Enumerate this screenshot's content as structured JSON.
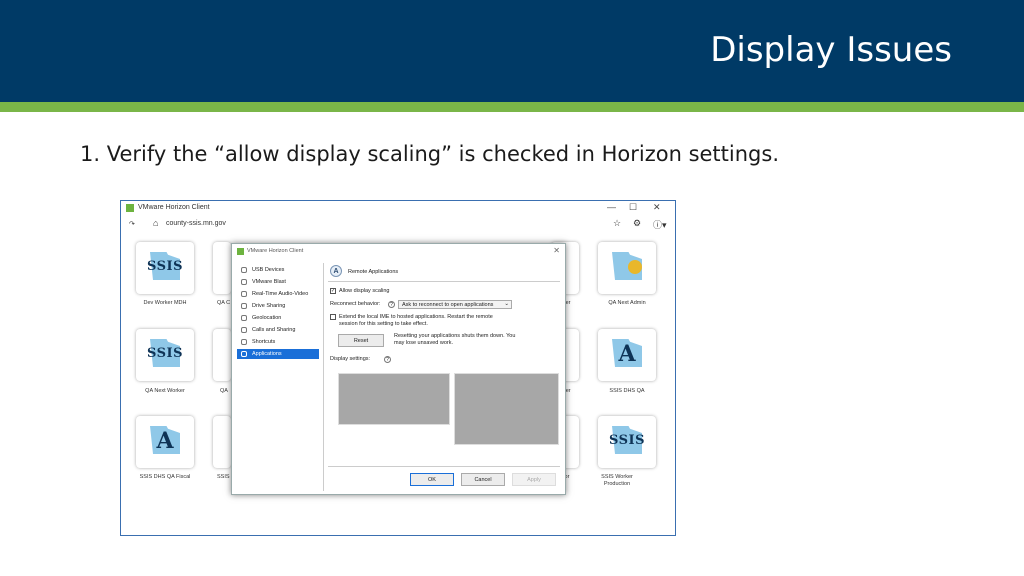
{
  "slide": {
    "title": "Display Issues",
    "step": "1.  Verify the “allow display scaling” is checked in Horizon settings.",
    "colors": {
      "header": "#003a66",
      "accent": "#7ab648"
    }
  },
  "screenshot": {
    "window": {
      "title": "VMware Horizon Client",
      "controls": [
        "—",
        "☐",
        "✕"
      ],
      "logo_icon": "vmware-horizon-icon"
    },
    "address": {
      "back": "↷",
      "home_icon": "home-icon",
      "host": "county-ssis.mn.gov",
      "right_icons": [
        "☆",
        "⚙",
        "ⓘ▾"
      ]
    },
    "tiles": [
      {
        "label": "Dev Worker MDH",
        "art": "SSIS"
      },
      {
        "label": "QA Next Worker",
        "art": "SSIS"
      },
      {
        "label": "SSIS DHS QA Fiscal",
        "art": "A"
      },
      {
        "label": "QA C",
        "art": ""
      },
      {
        "label": "QA",
        "art": ""
      },
      {
        "label": "SSIS",
        "art": ""
      },
      {
        "label": "rker",
        "art": ""
      },
      {
        "label": "ker",
        "art": ""
      },
      {
        "label": "for",
        "art": ""
      },
      {
        "label": "QA Next Admin",
        "art": "key"
      },
      {
        "label": "SSIS DHS QA",
        "art": "A"
      },
      {
        "label": "SSIS Worker Production",
        "art": "SSIS"
      }
    ],
    "dialog": {
      "title": "VMware Horizon Client",
      "close": "✕",
      "nav": [
        "USB Devices",
        "VMware Blast",
        "Real-Time Audio-Video",
        "Drive Sharing",
        "Geolocation",
        "Calls and Sharing",
        "Shortcuts",
        "Applications"
      ],
      "selected_nav_index": 7,
      "pane": {
        "heading": "Remote Applications",
        "heading_icon": "A",
        "allow_scaling_label": "Allow display scaling",
        "allow_scaling_checked": true,
        "check_mark": "✓",
        "reconnect_label": "Reconnect behavior:",
        "help": "?",
        "reconnect_value": "Ask to reconnect to open applications",
        "dropdown_arrow": "⌄",
        "ime_label_line1": "Extend the local IME to hosted applications. Restart the remote",
        "ime_label_line2": "session for this setting to take effect.",
        "ime_checked": false,
        "reset_button": "Reset",
        "reset_note_line1": "Resetting your applications shuts them down. You",
        "reset_note_line2": "may lose unsaved work.",
        "display_settings_label": "Display settings:"
      },
      "buttons": {
        "ok": "OK",
        "cancel": "Cancel",
        "apply": "Apply"
      }
    }
  }
}
